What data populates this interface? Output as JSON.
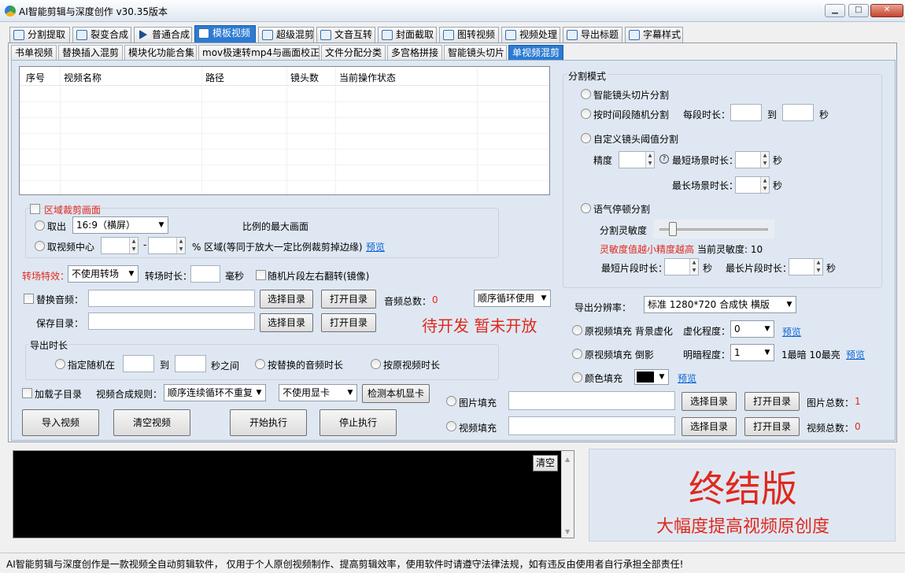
{
  "window": {
    "title": "AI智能剪辑与深度创作   v30.35版本",
    "minimize": "▁",
    "maximize": "□",
    "close": "✕"
  },
  "main_tabs": [
    "分割提取",
    "裂变合成",
    "普通合成",
    "模板视频",
    "超级混剪",
    "文音互转",
    "封面截取",
    "图转视频",
    "视频处理",
    "导出标题",
    "字幕样式"
  ],
  "sub_tabs": [
    "书单视频",
    "替换插入混剪",
    "模块化功能合集",
    "mov极速转mp4与画面校正",
    "文件分配分类",
    "多宫格拼接",
    "智能镜头切片",
    "单视频混剪"
  ],
  "table": {
    "headers": [
      "序号",
      "视频名称",
      "路径",
      "镜头数",
      "当前操作状态"
    ]
  },
  "crop": {
    "title": "区域裁剪画面",
    "take_out": "取出",
    "ratio_value": "16:9（横屏）",
    "ratio_desc": "比例的最大画面",
    "center_label": "取视频中心",
    "dash": "-",
    "region_desc": "% 区域(等同于放大一定比例裁剪掉边缘)",
    "preview": "预览"
  },
  "transition": {
    "label": "转场特效：",
    "value": "不使用转场",
    "duration_label": "转场时长：",
    "unit": "毫秒",
    "mirror": "随机片段左右翻转(镜像)"
  },
  "audio": {
    "replace_label": "替换音频：",
    "choose_dir": "选择目录",
    "open_dir": "打开目录",
    "total_label": "音频总数：",
    "total_value": "0",
    "order": "顺序循环使用"
  },
  "save": {
    "label": "保存目录：",
    "choose_dir": "选择目录",
    "open_dir": "打开目录"
  },
  "pending": "待开发 暂未开放",
  "export_duration": {
    "title": "导出时长",
    "random": "指定随机在",
    "to": "到",
    "between": "秒之间",
    "by_audio": "按替换的音频时长",
    "by_original": "按原视频时长"
  },
  "bottom_controls": {
    "subdir": "加载子目录",
    "rule_label": "视频合成规则：",
    "rule_value": "顺序连续循环不重复",
    "gpu_value": "不使用显卡",
    "detect_gpu": "检测本机显卡"
  },
  "actions": {
    "import": "导入视频",
    "clear": "清空视频",
    "start": "开始执行",
    "stop": "停止执行"
  },
  "split": {
    "title": "分割模式",
    "smart": "智能镜头切片分割",
    "by_time": "按时间段随机分割",
    "seg_len": "每段时长：",
    "to": "到",
    "sec": "秒",
    "custom": "自定义镜头阈值分割",
    "precision": "精度",
    "help": "?",
    "min_scene": "最短场景时长：",
    "max_scene": "最长场景时长：",
    "pause": "语气停顿分割",
    "sensitivity": "分割灵敏度",
    "sens_note": "灵敏度值越小精度越高",
    "sens_current": "当前灵敏度: 10",
    "sensitivity_value": 10,
    "min_clip": "最短片段时长：",
    "max_clip": "最长片段时长："
  },
  "export": {
    "resolution_label": "导出分辨率：",
    "resolution_value": "标准 1280*720 合成快 横版",
    "fill_blur": "原视频填充 背景虚化",
    "blur_label": "虚化程度：",
    "blur_value": "0",
    "preview": "预览",
    "fill_shadow": "原视频填充 倒影",
    "bright_label": "明暗程度：",
    "bright_value": "1",
    "bright_note": "1最暗 10最亮",
    "color_fill": "颜色填充",
    "image_fill": "图片填充",
    "choose_dir": "选择目录",
    "open_dir": "打开目录",
    "image_total_label": "图片总数：",
    "image_total": "1",
    "video_fill": "视频填充",
    "video_total_label": "视频总数：",
    "video_total": "0"
  },
  "log": {
    "clear": "清空"
  },
  "ad": {
    "title": "终结版",
    "subtitle": "大幅度提高视频原创度"
  },
  "status_bar": "AI智能剪辑与深度创作是一款视频全自动剪辑软件，  仅用于个人原创视频制作、提高剪辑效率，使用软件时请遵守法律法规，如有违反由使用者自行承担全部责任!",
  "colors": {
    "accent": "#2c7bd2",
    "red": "#e0281e",
    "link": "#0a64d6"
  }
}
